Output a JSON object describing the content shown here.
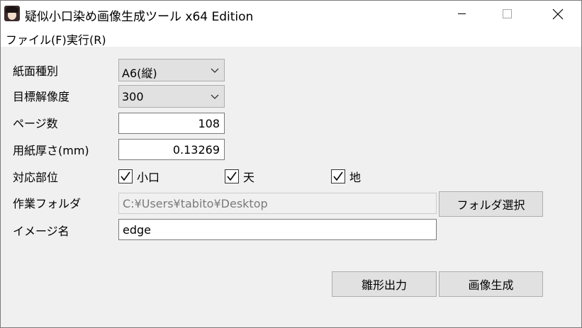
{
  "window": {
    "title": "疑似小口染め画像生成ツール x64 Edition",
    "icon": "app-anime-character-icon"
  },
  "menu": {
    "file": "ファイル(F)",
    "run": "実行(R)"
  },
  "form": {
    "paper_type": {
      "label": "紙面種別",
      "value": "A6(縦)"
    },
    "target_resolution": {
      "label": "目標解像度",
      "value": "300"
    },
    "page_count": {
      "label": "ページ数",
      "value": "108"
    },
    "paper_thickness": {
      "label": "用紙厚さ(mm)",
      "value": "0.13269"
    },
    "target_parts": {
      "label": "対応部位",
      "options": [
        {
          "label": "小口",
          "checked": true
        },
        {
          "label": "天",
          "checked": true
        },
        {
          "label": "地",
          "checked": true
        }
      ]
    },
    "work_folder": {
      "label": "作業フォルダ",
      "value": "C:¥Users¥tabito¥Desktop",
      "button": "フォルダ選択"
    },
    "image_name": {
      "label": "イメージ名",
      "value": "edge"
    }
  },
  "actions": {
    "shape_output": "雛形出力",
    "generate_image": "画像生成"
  }
}
